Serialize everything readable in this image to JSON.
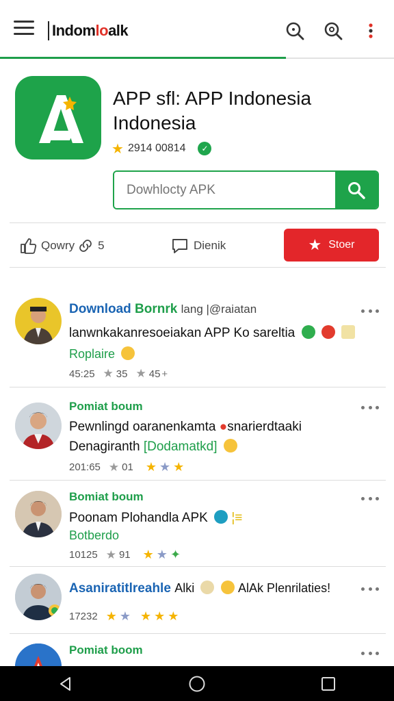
{
  "topbar": {
    "brand_part1": "Indom",
    "brand_part2": "lo",
    "brand_part3": "alk"
  },
  "app": {
    "title": "APP sfl: APP Indonesia Indonesia",
    "rating_count": "2914 00814",
    "download_placeholder": "Dowhlocty APK"
  },
  "actions": {
    "like_label": "Qowry",
    "comment_count": "5",
    "comment_label": "Dienik",
    "store_label": "Stoer"
  },
  "posts": [
    {
      "title": "Download",
      "title_rest": " Bornrk",
      "title_suffix": "lang |@raiatan",
      "text": "lanwnkakanresoeiakan APP Ko sareltia",
      "sub": "Roplaire",
      "time": "45:25",
      "stat1": "35",
      "stat2": "45"
    },
    {
      "title": "Pomiat boum",
      "text": "Pewnlingd oaranenkamta",
      "text_rest": "snarierdtaaki",
      "text2": "Denagiranth",
      "text2_green": "[Dodamatkd]",
      "time": "201:65",
      "stat1": "01"
    },
    {
      "title": "Bomiat boum",
      "text": "Poonam Plohandla APK",
      "sub": "Botberdo",
      "time": "10125",
      "stat1": "91"
    },
    {
      "title": "Asaniratitlreahle",
      "text_rest": "Alki",
      "text_tail": "AlAk Plenrilaties!",
      "time": "17232"
    },
    {
      "title": "Pomiat boom"
    }
  ],
  "colors": {
    "brand_green": "#1ea34a",
    "accent_red": "#e3262a",
    "link_blue": "#1a64b3"
  }
}
